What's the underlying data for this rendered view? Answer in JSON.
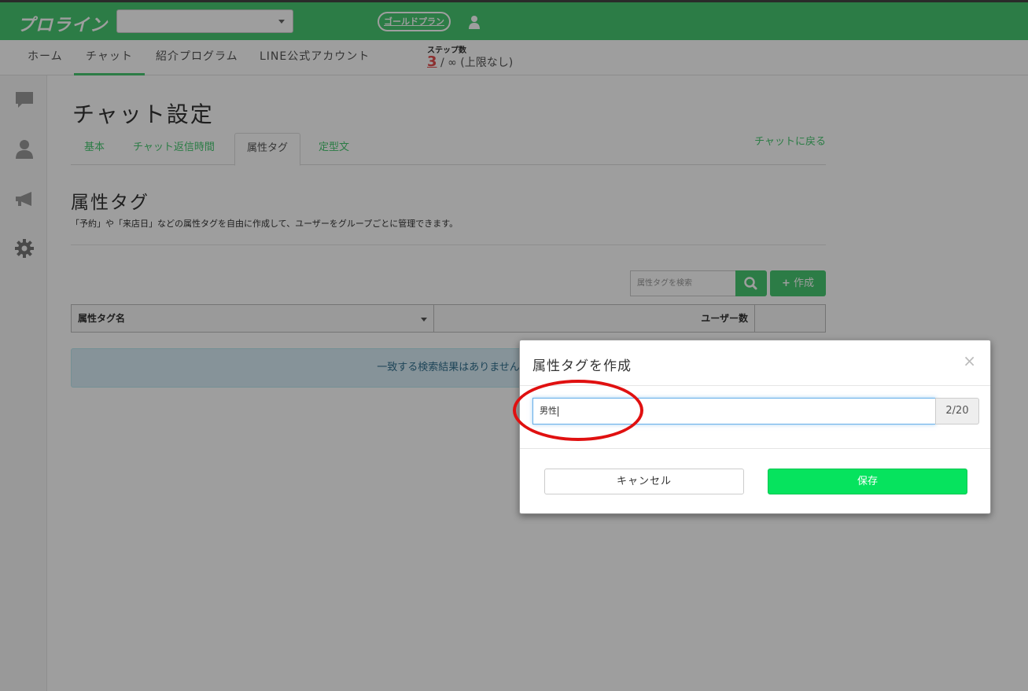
{
  "header": {
    "logo": "プロライン",
    "account_select_value": "",
    "plan_badge": "ゴールドプラン",
    "user_icon": "user-icon"
  },
  "nav": {
    "items": [
      "ホーム",
      "チャット",
      "紹介プログラム",
      "LINE公式アカウント"
    ],
    "active": "チャット",
    "steps_label": "ステップ数",
    "steps_current": "3",
    "steps_rest": "/ ∞ (上限なし)"
  },
  "sidebar": {
    "icons": [
      "chat-bubble-icon",
      "user-icon",
      "megaphone-icon",
      "gear-icon"
    ]
  },
  "main": {
    "page_title": "チャット設定",
    "tabs": [
      "基本",
      "チャット返信時間",
      "属性タグ",
      "定型文"
    ],
    "active_tab": "属性タグ",
    "back_link": "チャットに戻る",
    "section_title": "属性タグ",
    "section_desc": "「予約」や「来店日」などの属性タグを自由に作成して、ユーザーをグループごとに管理できます。",
    "search_placeholder": "属性タグを検索",
    "create_label": "作成",
    "table": {
      "col_name": "属性タグ名",
      "col_users": "ユーザー数",
      "col_actions": ""
    },
    "empty_message": "一致する検索結果はありません"
  },
  "modal": {
    "title": "属性タグを作成",
    "close": "×",
    "input_value": "男性",
    "counter": "2/20",
    "cancel_label": "キャンセル",
    "save_label": "保存"
  },
  "colors": {
    "brand_green": "#48c971",
    "save_green": "#06e35e",
    "annotation_red": "#e01010"
  }
}
